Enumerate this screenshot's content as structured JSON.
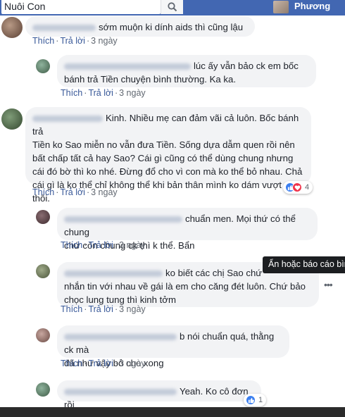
{
  "topbar": {
    "search_value": "Nuôi Con",
    "profile_name": "Phương"
  },
  "actions": {
    "like": "Thích",
    "reply": "Trả lời",
    "separator": "·"
  },
  "comments": [
    {
      "text": "sớm muộn ki dính aids thì cũng lậu",
      "time": "3 ngày"
    },
    {
      "text_lines": [
        "lúc ấy vẫn bảo ck em bốc",
        "bánh trả Tiền chuyện bình thường. Ka ka."
      ],
      "time": "3 ngày"
    },
    {
      "text_lines": [
        "Kinh. Nhiều mẹ can đảm vãi cả luôn. Bốc bánh trả",
        "Tiền ko Sao miễn no vẫn đưa Tiền. Sống dựa dẫm quen rồi nên",
        "bất chấp tất cả hay Sao? Cái gì cũng có thể dùng chung nhưng",
        "cái đó bờ thì ko nhé. Đừng đổ cho vì con mà ko thể bỏ nhau. Chả",
        "cái gì là ko thể chỉ không thể khi bản thân mình ko dám vượt qua",
        "thôi."
      ],
      "time": "3 ngày",
      "reaction_count": "4"
    },
    {
      "text_lines": [
        "chuẩn men. Mọi thứ có thể chung",
        "chứ còn chung ck thì k thể. Bẩn"
      ],
      "time": "3 ngày"
    },
    {
      "text_lines": [
        "ko biết các chị Sao chứ",
        "nhắn tin với nhau về gái là em cho căng đét luôn. Chứ bảo",
        "chọc lung tung thì kinh tởm"
      ],
      "time": "3 ngày"
    },
    {
      "text_lines": [
        "b nói chuẩn quá, thằng ck mà",
        "đã như vậy bỏ cho xong"
      ],
      "time": "3 ngày"
    },
    {
      "text": "Yeah. Ko cô đơn rồi",
      "reaction_count": "1"
    }
  ],
  "tooltip": "Ẩn hoặc báo cáo bình luận",
  "colors": {
    "brand": "#4267b2",
    "link": "#385898",
    "bubble": "#f2f3f5",
    "like": "#3b7ff0",
    "love": "#f0334b"
  }
}
